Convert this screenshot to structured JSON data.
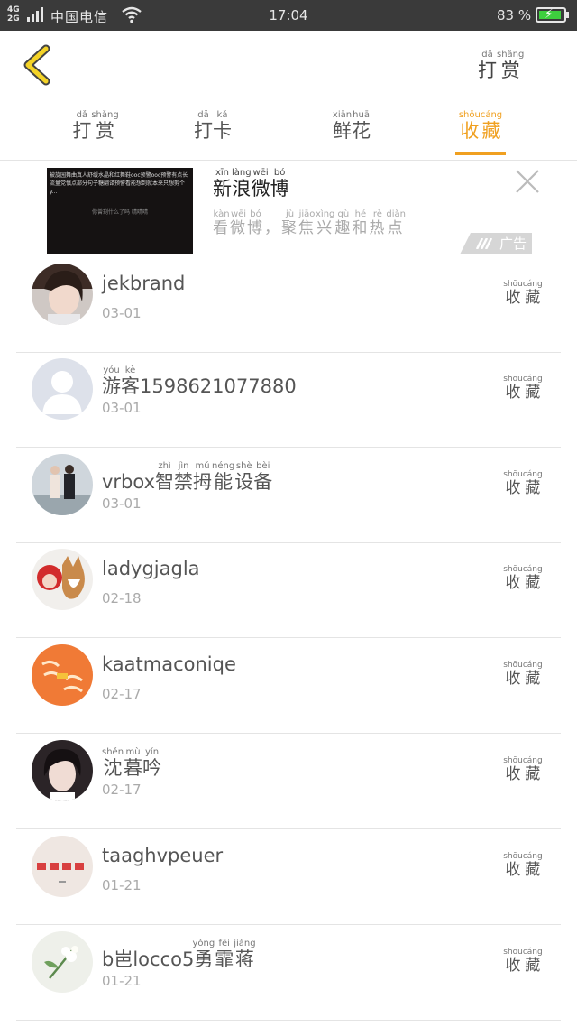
{
  "status_bar": {
    "network_top": "4G",
    "network_bottom": "2G",
    "carrier": "中国电信",
    "time": "17:04",
    "battery": "83 %"
  },
  "header": {
    "title": {
      "chars": [
        "打",
        "赏"
      ],
      "pinyin": [
        "dǎ",
        "shǎng"
      ]
    }
  },
  "tabs": [
    {
      "chars": [
        "打",
        "赏"
      ],
      "pinyin": [
        "dǎ",
        "shǎng"
      ],
      "active": false
    },
    {
      "chars": [
        "打",
        "卡"
      ],
      "pinyin": [
        "dǎ",
        "kǎ"
      ],
      "active": false
    },
    {
      "chars": [
        "鲜",
        "花"
      ],
      "pinyin": [
        "xiān",
        "huā"
      ],
      "active": false
    },
    {
      "chars": [
        "收",
        "藏"
      ],
      "pinyin": [
        "shōu",
        "cáng"
      ],
      "active": true
    }
  ],
  "accent_color": "#f0a020",
  "ad": {
    "thumb_text": "被旋园舞曲真人舒缓水晶和红舞鞋ooc预警ooc预警有点长流量党慎点部分句子糖翻译预警看能想到就本来只想剪个y...",
    "thumb_caption": "你曾剩什么了吗 晴晴晴",
    "title": {
      "chars": [
        "新",
        "浪",
        "微",
        "博"
      ],
      "pinyin": [
        "xīn",
        "làng",
        "wēi",
        "bó"
      ]
    },
    "subtitle": {
      "chars": [
        "看",
        "微",
        "博",
        "，",
        "聚",
        "焦",
        "兴",
        "趣",
        "和",
        "热",
        "点"
      ],
      "pinyin": [
        "kàn",
        "wēi",
        "bó",
        "",
        "jù",
        "jiāo",
        "xìng",
        "qù",
        "hé",
        "rè",
        "diǎn"
      ]
    },
    "badge": "广告"
  },
  "fav_button": {
    "chars": [
      "收",
      "藏"
    ],
    "pinyin": [
      "shōu",
      "cáng"
    ]
  },
  "users": [
    {
      "name_plain": "jekbrand",
      "name_chars": [],
      "name_pinyin": [],
      "date": "03-01"
    },
    {
      "name_plain": "",
      "name_chars": [
        "游",
        "客",
        "1598621077880"
      ],
      "name_pinyin": [
        "yóu",
        "kè",
        ""
      ],
      "date": "03-01"
    },
    {
      "name_plain": "",
      "name_chars": [
        "vrbox",
        "智",
        "禁",
        "拇",
        "能",
        "设",
        "备"
      ],
      "name_pinyin": [
        "",
        "zhì",
        "jìn",
        "mǔ",
        "néng",
        "shè",
        "bèi"
      ],
      "date": "03-01"
    },
    {
      "name_plain": "ladygjagla",
      "name_chars": [],
      "name_pinyin": [],
      "date": "02-18"
    },
    {
      "name_plain": "kaatmaconiqe",
      "name_chars": [],
      "name_pinyin": [],
      "date": "02-17"
    },
    {
      "name_plain": "",
      "name_chars": [
        "沈",
        "暮",
        "吟"
      ],
      "name_pinyin": [
        "shěn",
        "mù",
        "yín"
      ],
      "date": "02-17"
    },
    {
      "name_plain": "taaghvpeuer",
      "name_chars": [],
      "name_pinyin": [],
      "date": "01-21"
    },
    {
      "name_plain": "",
      "name_chars": [
        "b",
        "岜",
        "locco5",
        "勇",
        "霏",
        "蒋"
      ],
      "name_pinyin": [
        "",
        "",
        "",
        "yǒng",
        "fēi",
        "jiǎng"
      ],
      "date": "01-21"
    }
  ]
}
